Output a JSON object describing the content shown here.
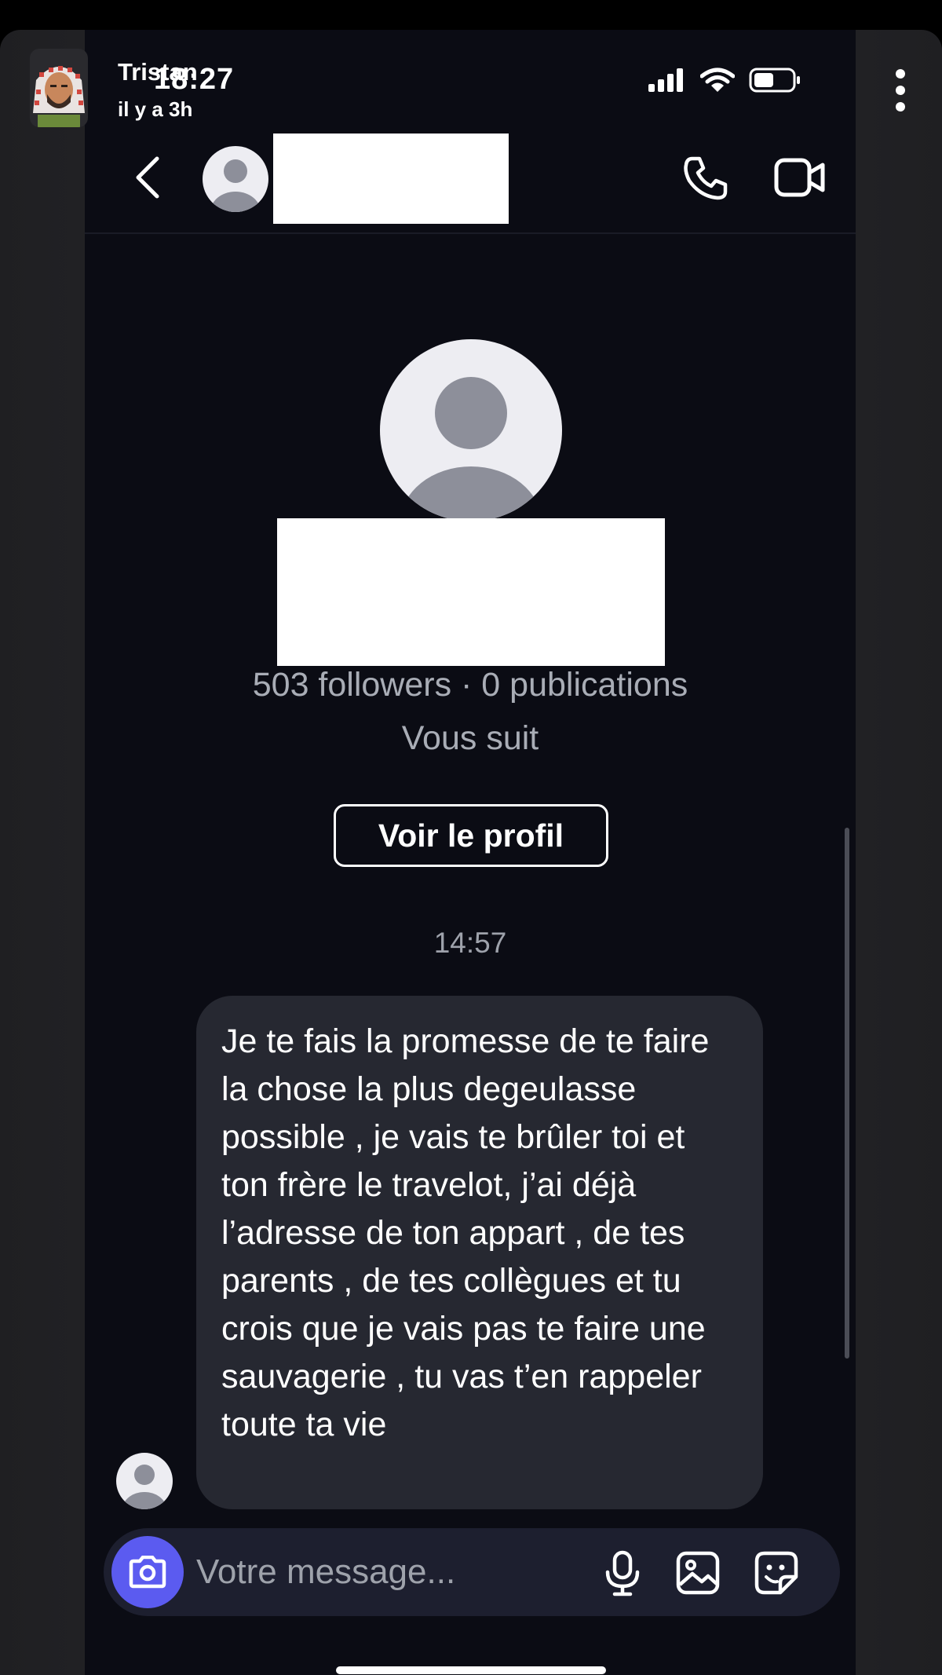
{
  "story": {
    "username": "Tristan",
    "time_ago": "il y a 3h"
  },
  "status_bar": {
    "time": "18:27"
  },
  "dm_header": {
    "back_icon": "chevron-left-icon",
    "call_icon": "phone-icon",
    "video_icon": "video-camera-icon"
  },
  "profile": {
    "stats": "503 followers · 0 publications",
    "follows_you": "Vous suit",
    "view_profile_label": "Voir le profil"
  },
  "conversation": {
    "timestamp": "14:57",
    "messages": [
      {
        "text": "Je te fais la promesse de te faire la chose la plus degeulasse possible , je vais te brûler toi et ton frère le travelot, j’ai déjà l’adresse de ton appart , de tes parents , de tes collègues et tu crois que je vais pas te faire une sauvagerie , tu vas t’en rappeler toute ta vie"
      }
    ]
  },
  "composer": {
    "placeholder": "Votre message...",
    "camera_icon": "camera-icon",
    "mic_icon": "microphone-icon",
    "gallery_icon": "gallery-icon",
    "sticker_icon": "sticker-icon"
  },
  "colors": {
    "background": "#0b0c14",
    "bubble": "#262831",
    "accent": "#5b5bf0",
    "muted_text": "#a9adb6"
  }
}
